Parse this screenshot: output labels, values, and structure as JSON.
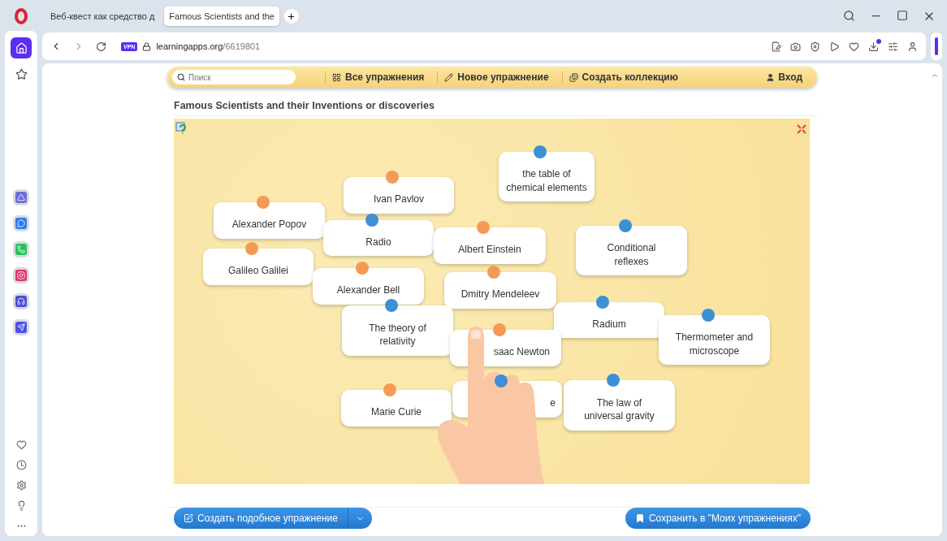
{
  "browser": {
    "tabs": [
      {
        "title": "Веб-квест как средство д",
        "selected": false
      },
      {
        "title": "Famous Scientists and the",
        "selected": true
      }
    ],
    "vpn_badge": "VPN",
    "address": {
      "domain": "learningapps.org",
      "path": "/6619801"
    }
  },
  "site_toolbar": {
    "search": {
      "placeholder": "Поиск"
    },
    "links": [
      "Все упражнения",
      "Новое упражнение",
      "Создать коллекцию"
    ],
    "login": "Вход"
  },
  "exercise": {
    "title": "Famous Scientists and their Inventions or discoveries",
    "cards": [
      {
        "text": "the table of chemical elements",
        "color": "#3d8fd6"
      },
      {
        "text": "Ivan Pavlov",
        "color": "#f59a55"
      },
      {
        "text": "Alexander Popov",
        "color": "#f59a55"
      },
      {
        "text": "Radio",
        "color": "#3d8fd6"
      },
      {
        "text": "Albert Einstein",
        "color": "#f59a55"
      },
      {
        "text": "Conditional reflexes",
        "color": "#3d8fd6"
      },
      {
        "text": "Galileo Galilei",
        "color": "#f59a55"
      },
      {
        "text": "Alexander Bell",
        "color": "#f59a55"
      },
      {
        "text": "Dmitry Mendeleev",
        "color": "#f59a55"
      },
      {
        "text": "The theory of relativity",
        "color": "#3d8fd6"
      },
      {
        "text": "Radium",
        "color": "#3d8fd6"
      },
      {
        "text": "saac Newton",
        "color": "#f59a55"
      },
      {
        "text": "Thermometer and microscope",
        "color": "#3d8fd6"
      },
      {
        "text": "Marie Curie",
        "color": "#f59a55"
      },
      {
        "text": "e",
        "color": "#3d8fd6"
      },
      {
        "text": "The law of universal gravity",
        "color": "#3d8fd6"
      }
    ]
  },
  "buttons": {
    "create_similar": "Создать подобное упражнение",
    "save": "Сохранить в \"Моих упражнениях\""
  }
}
